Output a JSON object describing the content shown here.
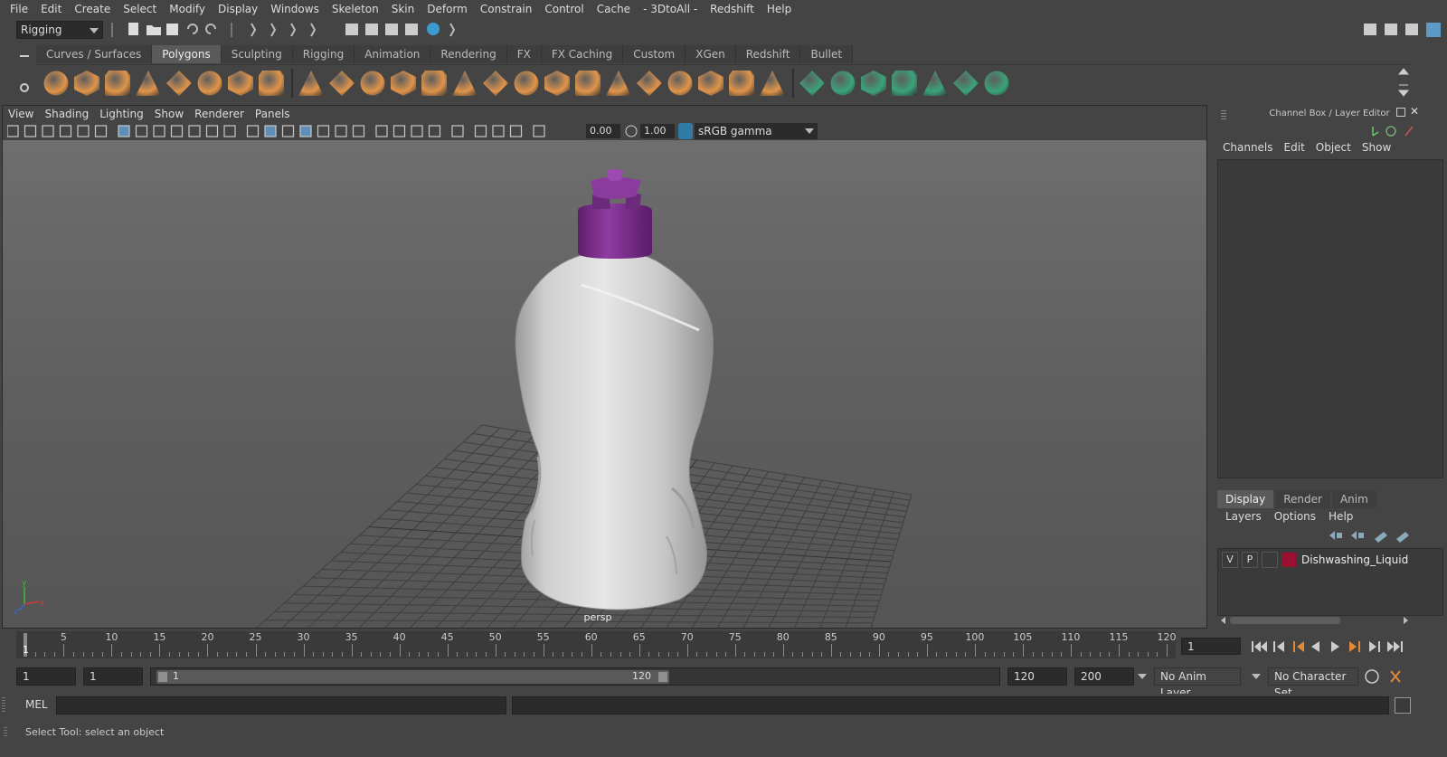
{
  "menubar": [
    "File",
    "Edit",
    "Create",
    "Select",
    "Modify",
    "Display",
    "Windows",
    "Skeleton",
    "Skin",
    "Deform",
    "Constrain",
    "Control",
    "Cache",
    "- 3DtoAll -",
    "Redshift",
    "Help"
  ],
  "status_line": {
    "mode": "Rigging"
  },
  "shelf_tabs": [
    "Curves / Surfaces",
    "Polygons",
    "Sculpting",
    "Rigging",
    "Animation",
    "Rendering",
    "FX",
    "FX Caching",
    "Custom",
    "XGen",
    "Redshift",
    "Bullet"
  ],
  "shelf_active": "Polygons",
  "viewport": {
    "menu": [
      "View",
      "Shading",
      "Lighting",
      "Show",
      "Renderer",
      "Panels"
    ],
    "exposure": "0.00",
    "gamma": "1.00",
    "color_space": "sRGB gamma",
    "camera_label": "persp",
    "axis_x": "x",
    "axis_y": "y",
    "axis_z": "z"
  },
  "channel_box": {
    "title": "Channel Box / Layer Editor",
    "menu": [
      "Channels",
      "Edit",
      "Object",
      "Show"
    ]
  },
  "layer_editor": {
    "tabs": [
      "Display",
      "Render",
      "Anim"
    ],
    "active_tab": "Display",
    "menu": [
      "Layers",
      "Options",
      "Help"
    ],
    "layers": [
      {
        "visible": "V",
        "playback": "P",
        "name": "Dishwashing_Liquid",
        "color": "#9b1030"
      }
    ]
  },
  "timeline": {
    "ticks": [
      "5",
      "10",
      "15",
      "20",
      "25",
      "30",
      "35",
      "40",
      "45",
      "50",
      "55",
      "60",
      "65",
      "70",
      "75",
      "80",
      "85",
      "90",
      "95",
      "100",
      "105",
      "110",
      "115",
      "120"
    ],
    "start_marker": "1",
    "current_frame": "1"
  },
  "range": {
    "start": "1",
    "playback_start": "1",
    "slider_start": "1",
    "slider_end": "120",
    "playback_end": "120",
    "end": "200",
    "anim_layer": "No Anim Layer",
    "character_set": "No Character Set"
  },
  "command_line": {
    "label": "MEL"
  },
  "help_line": "Select Tool: select an object",
  "colors": {
    "bottle": "#d8d8d8",
    "cap": "#7a2a8a",
    "shelf_icon": "#e0944a",
    "shelf_icon_green": "#3aa37a"
  }
}
